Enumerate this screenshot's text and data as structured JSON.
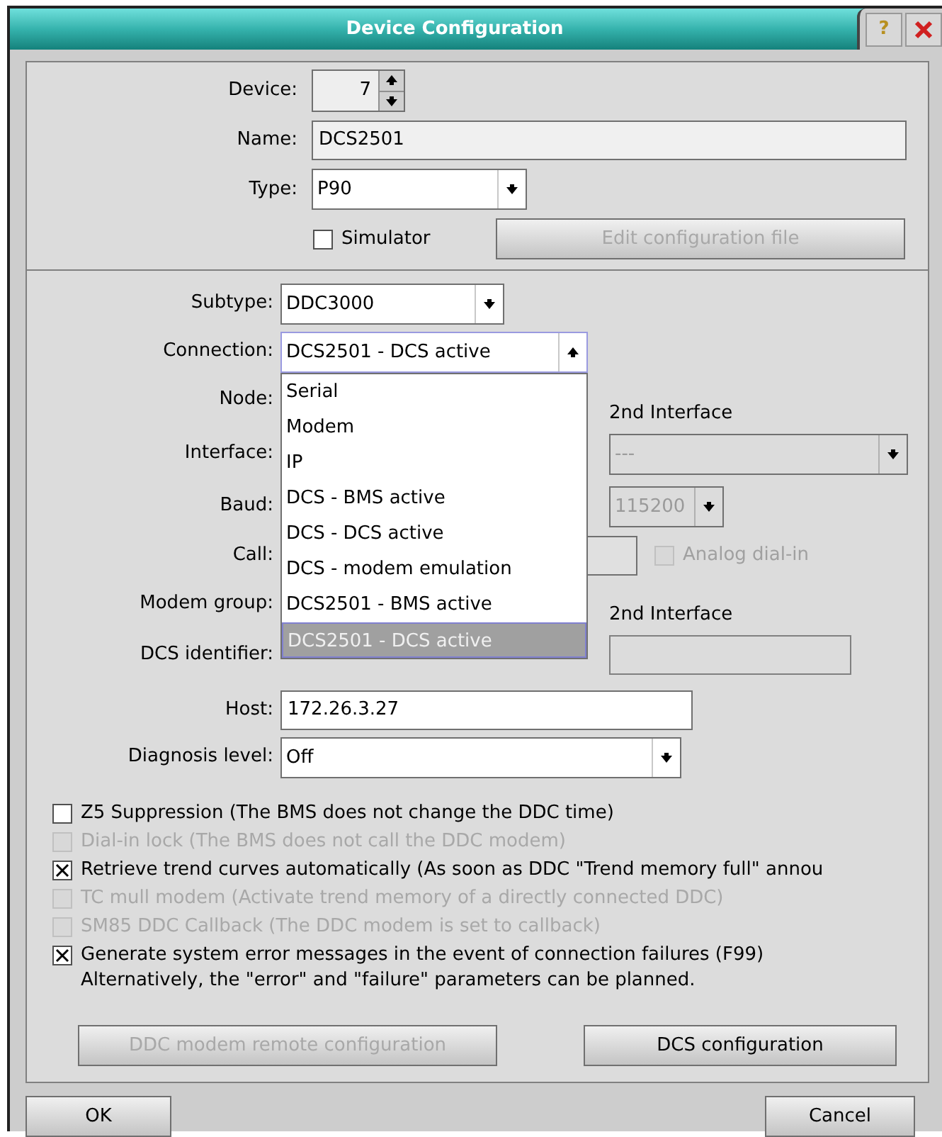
{
  "window": {
    "title": "Device Configuration",
    "help": "?"
  },
  "device": {
    "label": "Device:",
    "value": "7"
  },
  "name": {
    "label": "Name:",
    "value": "DCS2501"
  },
  "type": {
    "label": "Type:",
    "value": "P90"
  },
  "simulator": {
    "label": "Simulator",
    "checked": false
  },
  "edit_button": {
    "label": "Edit configuration file",
    "disabled": true
  },
  "subtype": {
    "label": "Subtype:",
    "value": "DDC3000"
  },
  "connection": {
    "label": "Connection:",
    "value": "DCS2501 - DCS active",
    "expanded": true,
    "options": [
      {
        "label": "Serial",
        "selected": false
      },
      {
        "label": "Modem",
        "selected": false
      },
      {
        "label": "IP",
        "selected": false
      },
      {
        "label": "DCS - BMS active",
        "selected": false
      },
      {
        "label": "DCS - DCS active",
        "selected": false
      },
      {
        "label": "DCS - modem emulation",
        "selected": false
      },
      {
        "label": "DCS2501 - BMS active",
        "selected": false
      },
      {
        "label": "DCS2501 - DCS active",
        "selected": true
      }
    ]
  },
  "node": {
    "label": "Node:",
    "second_heading": "2nd Interface"
  },
  "interface": {
    "label": "Interface:",
    "second_value": "---",
    "second_disabled": true
  },
  "baud": {
    "label": "Baud:",
    "second_value": "115200",
    "second_disabled": true
  },
  "call": {
    "label": "Call:",
    "analog_dial_in": {
      "label": "Analog dial-in",
      "checked": false,
      "disabled": true
    }
  },
  "modem_group": {
    "label": "Modem group:",
    "second_heading": "2nd Interface"
  },
  "dcs_identifier": {
    "label": "DCS identifier:"
  },
  "host": {
    "label": "Host:",
    "value": "172.26.3.27"
  },
  "diagnosis_level": {
    "label": "Diagnosis level:",
    "value": "Off"
  },
  "options": [
    {
      "label": "Z5 Suppression (The BMS does not change the DDC time)",
      "checked": false,
      "disabled": false
    },
    {
      "label": "Dial-in lock (The BMS does not call the DDC modem)",
      "checked": false,
      "disabled": true
    },
    {
      "label": "Retrieve trend curves automatically (As soon as DDC \"Trend memory full\" annou",
      "checked": true,
      "disabled": false
    },
    {
      "label": "TC mull modem (Activate trend memory of a directly connected DDC)",
      "checked": false,
      "disabled": true
    },
    {
      "label": "SM85 DDC Callback (The DDC modem is set to callback)",
      "checked": false,
      "disabled": true
    },
    {
      "label": "Generate system error messages in the event of connection failures (F99)",
      "checked": true,
      "disabled": false,
      "note": "Alternatively, the \"error\" and \"failure\" parameters can be planned."
    }
  ],
  "action_buttons": [
    {
      "label": "DDC modem remote configuration",
      "disabled": true
    },
    {
      "label": "DCS configuration",
      "disabled": false
    }
  ],
  "dialog_buttons": [
    {
      "label": "OK"
    },
    {
      "label": "Cancel"
    }
  ]
}
